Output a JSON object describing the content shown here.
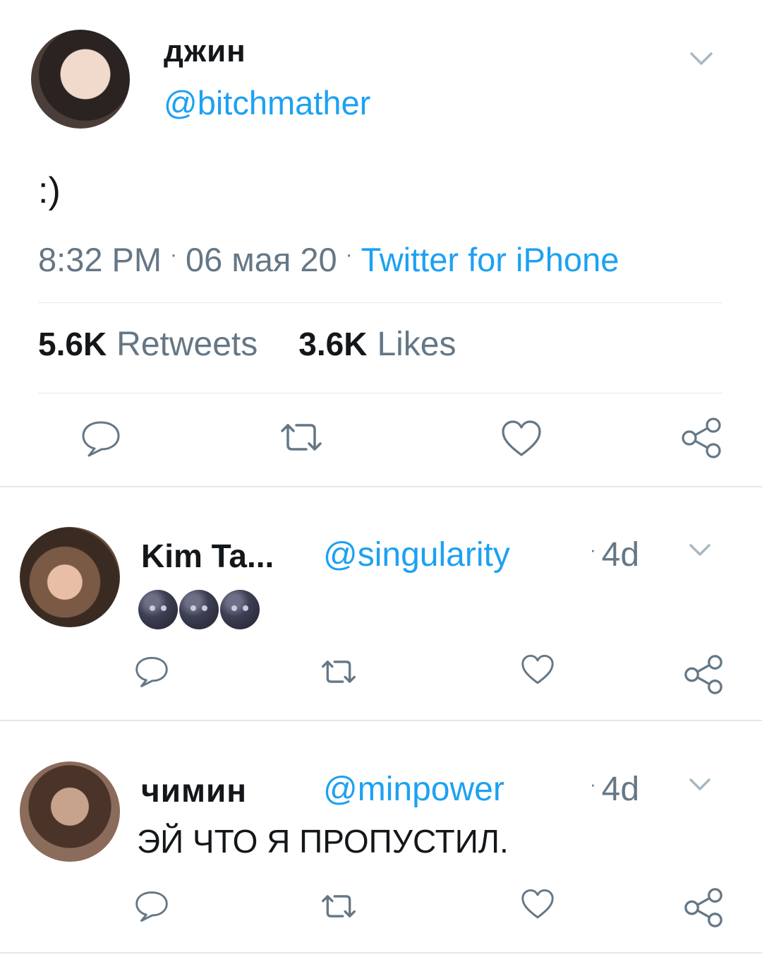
{
  "main_tweet": {
    "author_name": "джин",
    "author_handle": "@bitchmather",
    "text": ":)",
    "time": "8:32 PM",
    "date": "06 мая 20",
    "source": "Twitter for iPhone",
    "retweets_count": "5.6K",
    "retweets_label": "Retweets",
    "likes_count": "3.6K",
    "likes_label": "Likes"
  },
  "replies": [
    {
      "name": "Kim Ta...",
      "handle": "@singularity",
      "time": "4d",
      "text_emoji": [
        "new-moon-face",
        "new-moon-face",
        "new-moon-face"
      ]
    },
    {
      "name": "чимин",
      "handle": "@minpower",
      "time": "4d",
      "text": "ЭЙ ЧТО Я ПРОПУСТИЛ."
    }
  ],
  "icons": {
    "reply": "reply-bubble-icon",
    "retweet": "retweet-icon",
    "like": "heart-icon",
    "share": "share-icon",
    "menu": "chevron-down-icon"
  },
  "colors": {
    "accent": "#1da1f2",
    "text": "#14171a",
    "secondary": "#657786",
    "divider": "#e1e8ed"
  }
}
